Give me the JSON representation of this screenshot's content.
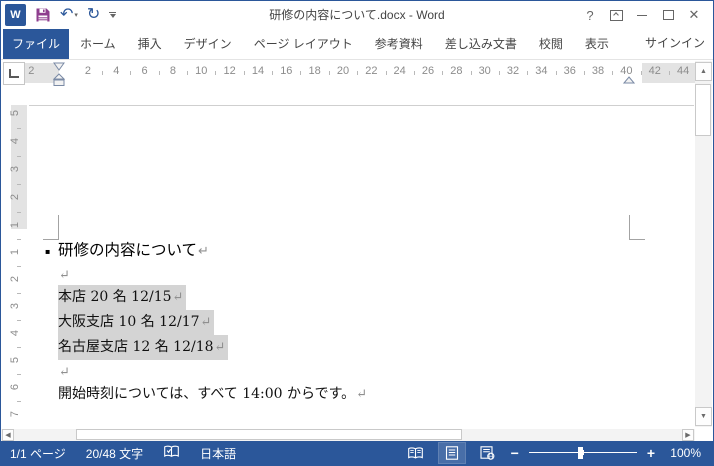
{
  "titlebar": {
    "title": "研修の内容について.docx - Word",
    "help_glyph": "?",
    "close_glyph": "✕",
    "word_logo_glyph": "W",
    "undo_glyph": "↶",
    "redo_glyph": "↻"
  },
  "ribbon": {
    "tabs": [
      {
        "label": "ファイル",
        "active": true
      },
      {
        "label": "ホーム"
      },
      {
        "label": "挿入"
      },
      {
        "label": "デザイン"
      },
      {
        "label": "ページ レイアウト"
      },
      {
        "label": "参考資料"
      },
      {
        "label": "差し込み文書"
      },
      {
        "label": "校閲"
      },
      {
        "label": "表示"
      }
    ],
    "signin_label": "サインイン"
  },
  "ruler": {
    "h_margin_left_number": "2",
    "h_numbers": [
      "2",
      "4",
      "6",
      "8",
      "10",
      "12",
      "14",
      "16",
      "18",
      "20",
      "22",
      "24",
      "26",
      "28",
      "30",
      "32",
      "34",
      "36",
      "38",
      "40"
    ],
    "h_margin_right_numbers": [
      "42",
      "44"
    ],
    "v_margin_numbers": [
      "5",
      "4",
      "3",
      "2",
      "1"
    ],
    "v_numbers": [
      "1",
      "2",
      "3",
      "4",
      "5",
      "6",
      "7"
    ]
  },
  "document": {
    "lines": [
      {
        "text": "研修の内容について",
        "mark": "↵",
        "bullet": "▪"
      },
      {
        "text": "",
        "mark": "↵"
      },
      {
        "text": "本店 20 名 12/15",
        "mark": "↵"
      },
      {
        "text": "大阪支店 10 名 12/17",
        "mark": "↵"
      },
      {
        "text": "名古屋支店 12 名 12/18",
        "mark": "↵"
      },
      {
        "text": "",
        "mark": "↵"
      },
      {
        "text": "開始時刻については、すべて 14:00 からです。",
        "mark": "↵"
      }
    ]
  },
  "scroll": {
    "up_glyph": "▲",
    "down_glyph": "▼",
    "left_glyph": "◀",
    "right_glyph": "▶"
  },
  "statusbar": {
    "page_indicator": "1/1 ページ",
    "word_count": "20/48 文字",
    "language": "日本語",
    "zoom_out": "−",
    "zoom_in": "+",
    "zoom_level": "100%"
  },
  "colors": {
    "accent": "#2b579a",
    "selection_highlight": "#d4d4d4",
    "save_icon": "#8e3e8e"
  }
}
